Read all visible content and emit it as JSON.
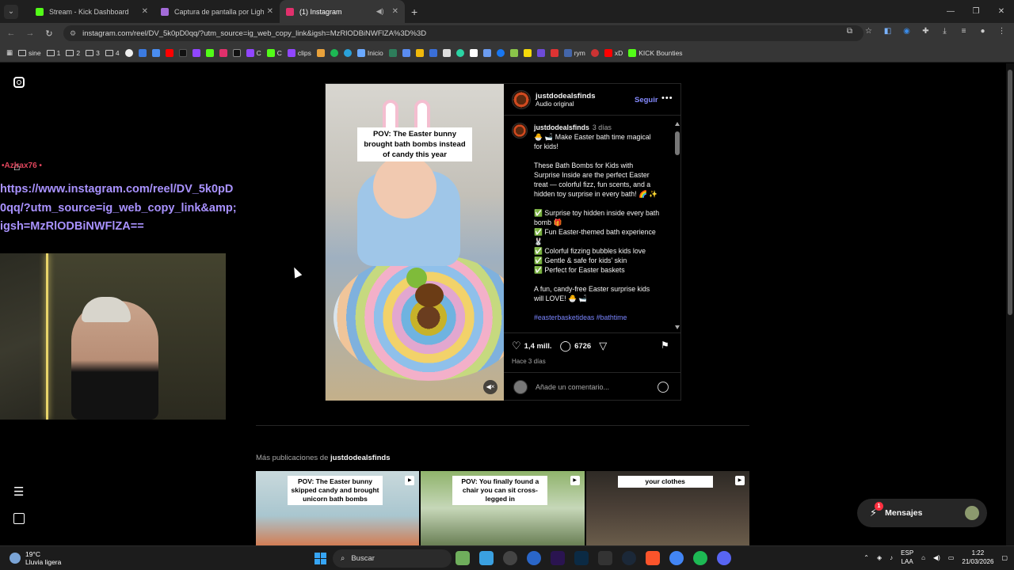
{
  "browser": {
    "tabs": [
      {
        "title": "Stream - Kick Dashboard",
        "color": "#53fc18",
        "active": false
      },
      {
        "title": "Captura de pantalla por Lightshot",
        "color": "#a36bd8",
        "active": false
      },
      {
        "title": "(1) Instagram",
        "color": "#e1306c",
        "active": true
      }
    ],
    "url": "instagram.com/reel/DV_5k0pD0qq/?utm_source=ig_web_copy_link&igsh=MzRlODBiNWFlZA%3D%3D",
    "bookmarks": [
      {
        "label": "sine",
        "type": "folder"
      },
      {
        "label": "1",
        "type": "folder"
      },
      {
        "label": "2",
        "type": "folder"
      },
      {
        "label": "3",
        "type": "folder"
      },
      {
        "label": "4",
        "type": "folder"
      },
      {
        "label": "C",
        "type": "twitch"
      },
      {
        "label": "C",
        "type": "kick"
      },
      {
        "label": "clips",
        "type": "twitch"
      },
      {
        "label": "Inicio",
        "type": "site"
      },
      {
        "label": "rym",
        "type": "site"
      },
      {
        "label": "xD",
        "type": "youtube"
      },
      {
        "label": "KICK Bounties",
        "type": "kick"
      }
    ]
  },
  "overlay": {
    "username": "•Azlrax76 •",
    "url_text": "https://www.instagram.com/reel/DV_5k0pD0qq/?utm_source=ig_web_copy_link&amp;igsh=MzRlODBiNWFlZA=="
  },
  "post": {
    "video_caption": "POV: The Easter bunny brought bath bombs instead of candy this year",
    "author": "justdodealsfinds",
    "audio": "Audio original",
    "follow_label": "Seguir",
    "comment_author": "justdodealsfinds",
    "comment_time": "3 días",
    "caption_paragraphs": [
      "🐣 🛁 Make Easter bath time magical for kids!",
      "These Bath Bombs for Kids with Surprise Inside are the perfect Easter treat — colorful fizz, fun scents, and a hidden toy surprise in every bath! 🌈 ✨",
      "✅ Surprise toy hidden inside every bath bomb 🎁",
      "✅ Fun Easter-themed bath experience 🐰",
      "✅ Colorful fizzing bubbles kids love",
      "✅ Gentle & safe for kids' skin",
      "✅ Perfect for Easter baskets",
      "A fun, candy-free Easter surprise kids will LOVE! 🐣 🛁"
    ],
    "hashtags": "#easterbasketideas #bathtime",
    "likes": "1,4 mill.",
    "comments": "6726",
    "posted_ago": "Hace 3 días",
    "add_comment_placeholder": "Añade un comentario..."
  },
  "more": {
    "label": "Más publicaciones de",
    "author": "justdodealsfinds",
    "thumbs": [
      {
        "caption": "POV: The Easter bunny skipped candy and brought unicorn bath bombs"
      },
      {
        "caption": "POV: You finally found a chair you can sit cross-legged in"
      },
      {
        "caption": "your clothes"
      }
    ]
  },
  "messages": {
    "label": "Mensajes",
    "badge": "1"
  },
  "taskbar": {
    "temp": "19°C",
    "weather": "Lluvia ligera",
    "search": "Buscar",
    "lang1": "ESP",
    "lang2": "LAA",
    "time": "1:22",
    "date": "21/03/2026"
  }
}
